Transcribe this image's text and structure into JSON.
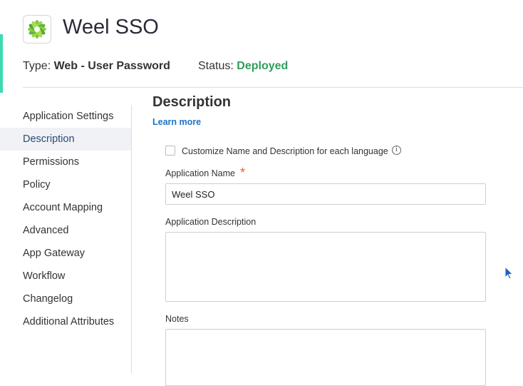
{
  "app": {
    "title": "Weel SSO",
    "type_label": "Type:",
    "type_value": "Web - User Password",
    "status_label": "Status:",
    "status_value": "Deployed"
  },
  "sidebar": {
    "items": [
      {
        "label": "Application Settings"
      },
      {
        "label": "Description"
      },
      {
        "label": "Permissions"
      },
      {
        "label": "Policy"
      },
      {
        "label": "Account Mapping"
      },
      {
        "label": "Advanced"
      },
      {
        "label": "App Gateway"
      },
      {
        "label": "Workflow"
      },
      {
        "label": "Changelog"
      },
      {
        "label": "Additional Attributes"
      }
    ]
  },
  "main": {
    "section_title": "Description",
    "learn_more": "Learn more",
    "customize_label": "Customize Name and Description for each language",
    "app_name_label": "Application Name",
    "required_marker": "*",
    "app_name_value": "Weel SSO",
    "app_description_label": "Application Description",
    "app_description_value": "",
    "notes_label": "Notes",
    "notes_value": ""
  },
  "colors": {
    "accent": "#3ddbb0",
    "deployed": "#2e9e58",
    "link": "#1a73c8",
    "required": "#e0622b"
  }
}
